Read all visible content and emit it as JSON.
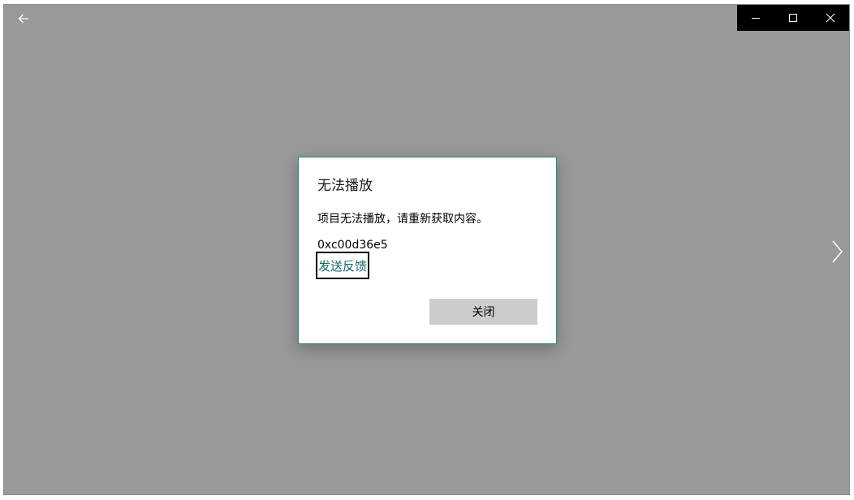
{
  "window": {
    "back_icon": "back-arrow-icon",
    "next_icon": "chevron-right-icon",
    "caption": {
      "minimize_icon": "minimize-icon",
      "maximize_icon": "maximize-icon",
      "close_icon": "close-icon"
    },
    "colors": {
      "background": "#999999",
      "caption_bar": "#000000"
    }
  },
  "dialog": {
    "title": "无法播放",
    "message": "项目无法播放，请重新获取内容。",
    "error_code": "0xc00d36e5",
    "feedback_link": "发送反馈",
    "close_button": "关闭",
    "colors": {
      "border": "#1f8a80",
      "link": "#0a6a64",
      "button": "#cccccc"
    }
  }
}
